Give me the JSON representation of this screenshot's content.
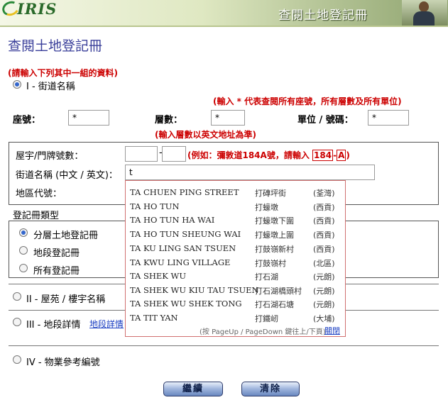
{
  "header": {
    "logo_text": "IRIS",
    "title": "查閱土地登記冊"
  },
  "page_title": "查閱土地登記冊",
  "instruction": "(請輸入下列其中一組的資料)",
  "section1": {
    "label": "I - 街道名稱",
    "note_asterisk": "(輸入 * 代表查閱所有座號，所有層數及所有單位)",
    "block_label": "座號：",
    "block_value": "*",
    "floor_label": "層數：",
    "floor_value": "*",
    "unit_label": "單位 / 號碼：",
    "unit_value": "*",
    "note_floor": "(輸入層數以英文地址為準)",
    "house_no_label": "屋宇/門牌號數：",
    "house_dash": "-",
    "house_example": "(例如：彌敦道184A號，請輸入",
    "example_num": "184",
    "example_dash": "-",
    "example_letter": "A",
    "example_close": ")",
    "street_label": "街道名稱 (中文 / 英文)：",
    "street_value": "t",
    "district_label": "地區代號："
  },
  "register_type": {
    "title": "登記冊類型",
    "options": [
      "分層土地登記冊",
      "地段登記冊",
      "所有登記冊"
    ],
    "selected": 0
  },
  "section2": {
    "label": "II - 屋苑 / 樓宇名稱"
  },
  "section3": {
    "label": "III - 地段詳情",
    "link": "地段詳情"
  },
  "section4": {
    "label": "IV - 物業參考編號"
  },
  "dropdown": {
    "items": [
      {
        "en": "TA CHUEN PING STREET",
        "zh": "打磚坪街",
        "district": "(荃灣)"
      },
      {
        "en": "TA HO TUN",
        "zh": "打蠔墩",
        "district": "(西貢)"
      },
      {
        "en": "TA HO TUN HA WAI",
        "zh": "打蠔墩下圍",
        "district": "(西貢)"
      },
      {
        "en": "TA HO TUN SHEUNG WAI",
        "zh": "打蠔墩上圍",
        "district": "(西貢)"
      },
      {
        "en": "TA KU LING SAN TSUEN",
        "zh": "打鼓嶺新村",
        "district": "(西貢)"
      },
      {
        "en": "TA KWU LING VILLAGE",
        "zh": "打鼓嶺村",
        "district": "(北區)"
      },
      {
        "en": "TA SHEK WU",
        "zh": "打石湖",
        "district": "(元朗)"
      },
      {
        "en": "TA SHEK WU KIU TAU TSUEN",
        "zh": "打石湖橋頭村",
        "district": "(元朗)"
      },
      {
        "en": "TA SHEK WU SHEK TONG",
        "zh": "打石湖石塘",
        "district": "(元朗)"
      },
      {
        "en": "TA TIT YAN",
        "zh": "打鐵屻",
        "district": "(大埔)"
      }
    ],
    "footer": "(按 PageUp / PageDown 鍵往上/下頁)",
    "close": "關閉"
  },
  "buttons": {
    "continue": "繼續",
    "clear": "清除"
  }
}
